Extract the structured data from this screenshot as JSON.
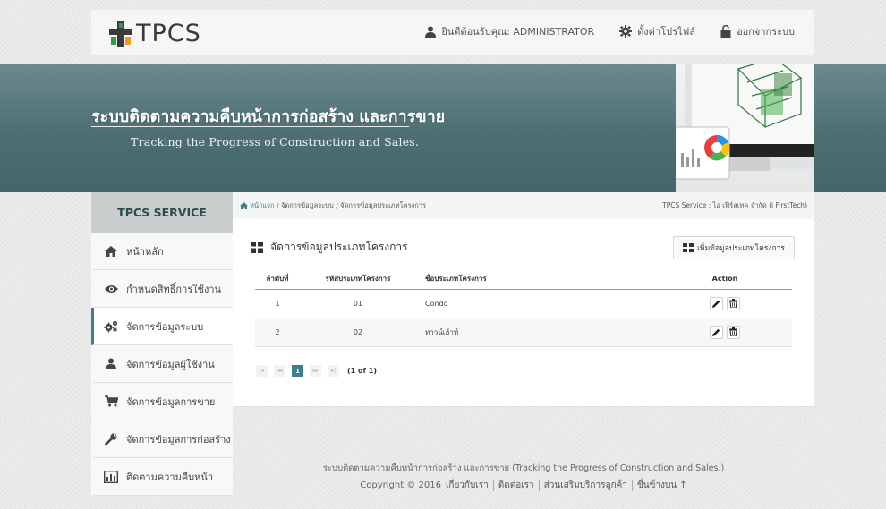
{
  "header": {
    "logo_text": "TPCS",
    "welcome": "ยินดีต้อนรับคุณ: ADMINISTRATOR",
    "profile": "ตั้งค่าโปรไฟล์",
    "logout": "ออกจากระบบ"
  },
  "banner": {
    "title": "ระบบติดตามความคืบหน้าการก่อสร้าง และการขาย",
    "subtitle": "Tracking the Progress of Construction and Sales."
  },
  "breadcrumb": {
    "home": "หน้าแรก",
    "items": [
      "จัดการข้อมูลระบบ",
      "จัดการข้อมูลประเภทโครงการ"
    ],
    "company": "TPCS Service : ไอ เฟิร์สเทค จำกัด (i FirstTech)"
  },
  "sidebar": {
    "heading": "TPCS SERVICE",
    "items": [
      {
        "label": "หน้าหลัก",
        "icon": "home-icon"
      },
      {
        "label": "กำหนดสิทธิ์การใช้งาน",
        "icon": "eye-icon"
      },
      {
        "label": "จัดการข้อมูลระบบ",
        "icon": "gears-icon"
      },
      {
        "label": "จัดการข้อมูลผู้ใช้งาน",
        "icon": "user-icon"
      },
      {
        "label": "จัดการข้อมูลการขาย",
        "icon": "cart-icon"
      },
      {
        "label": "จัดการข้อมูลการก่อสร้าง",
        "icon": "wrench-icon"
      },
      {
        "label": "ติดตามความคืบหน้า",
        "icon": "bar-chart-icon"
      }
    ],
    "active_index": 2
  },
  "panel": {
    "title": "จัดการข้อมูลประเภทโครงการ",
    "add_button": "เพิ่มข้อมูลประเภทโครงการ",
    "columns": [
      "ลำดับที่",
      "รหัสประเภทโครงการ",
      "ชื่อประเภทโครงการ",
      "Action"
    ],
    "rows": [
      [
        "1",
        "01",
        "Condo"
      ],
      [
        "2",
        "02",
        "ทาวน์เฮ้าท์"
      ]
    ],
    "pager": {
      "first": "|◂",
      "prev": "◂◂",
      "current": "1",
      "next": "▸▸",
      "last": "▸|",
      "info": "(1 of 1)"
    }
  },
  "footer": {
    "line1": "ระบบติดตามความคืบหน้าการก่อสร้าง และการขาย (Tracking the Progress of Construction and Sales.)",
    "copyright": "Copyright © 2016",
    "links": [
      "เกี่ยวกับเรา",
      "ติดต่อเรา",
      "ส่วนเสริมบริการลูกค้า",
      "ขึ้นข้างบน ↑"
    ]
  },
  "colors": {
    "accent": "#3c7f8a",
    "banner": "#4d6f72",
    "logo_orange": "#f39a1e",
    "logo_green": "#2e9e48"
  }
}
